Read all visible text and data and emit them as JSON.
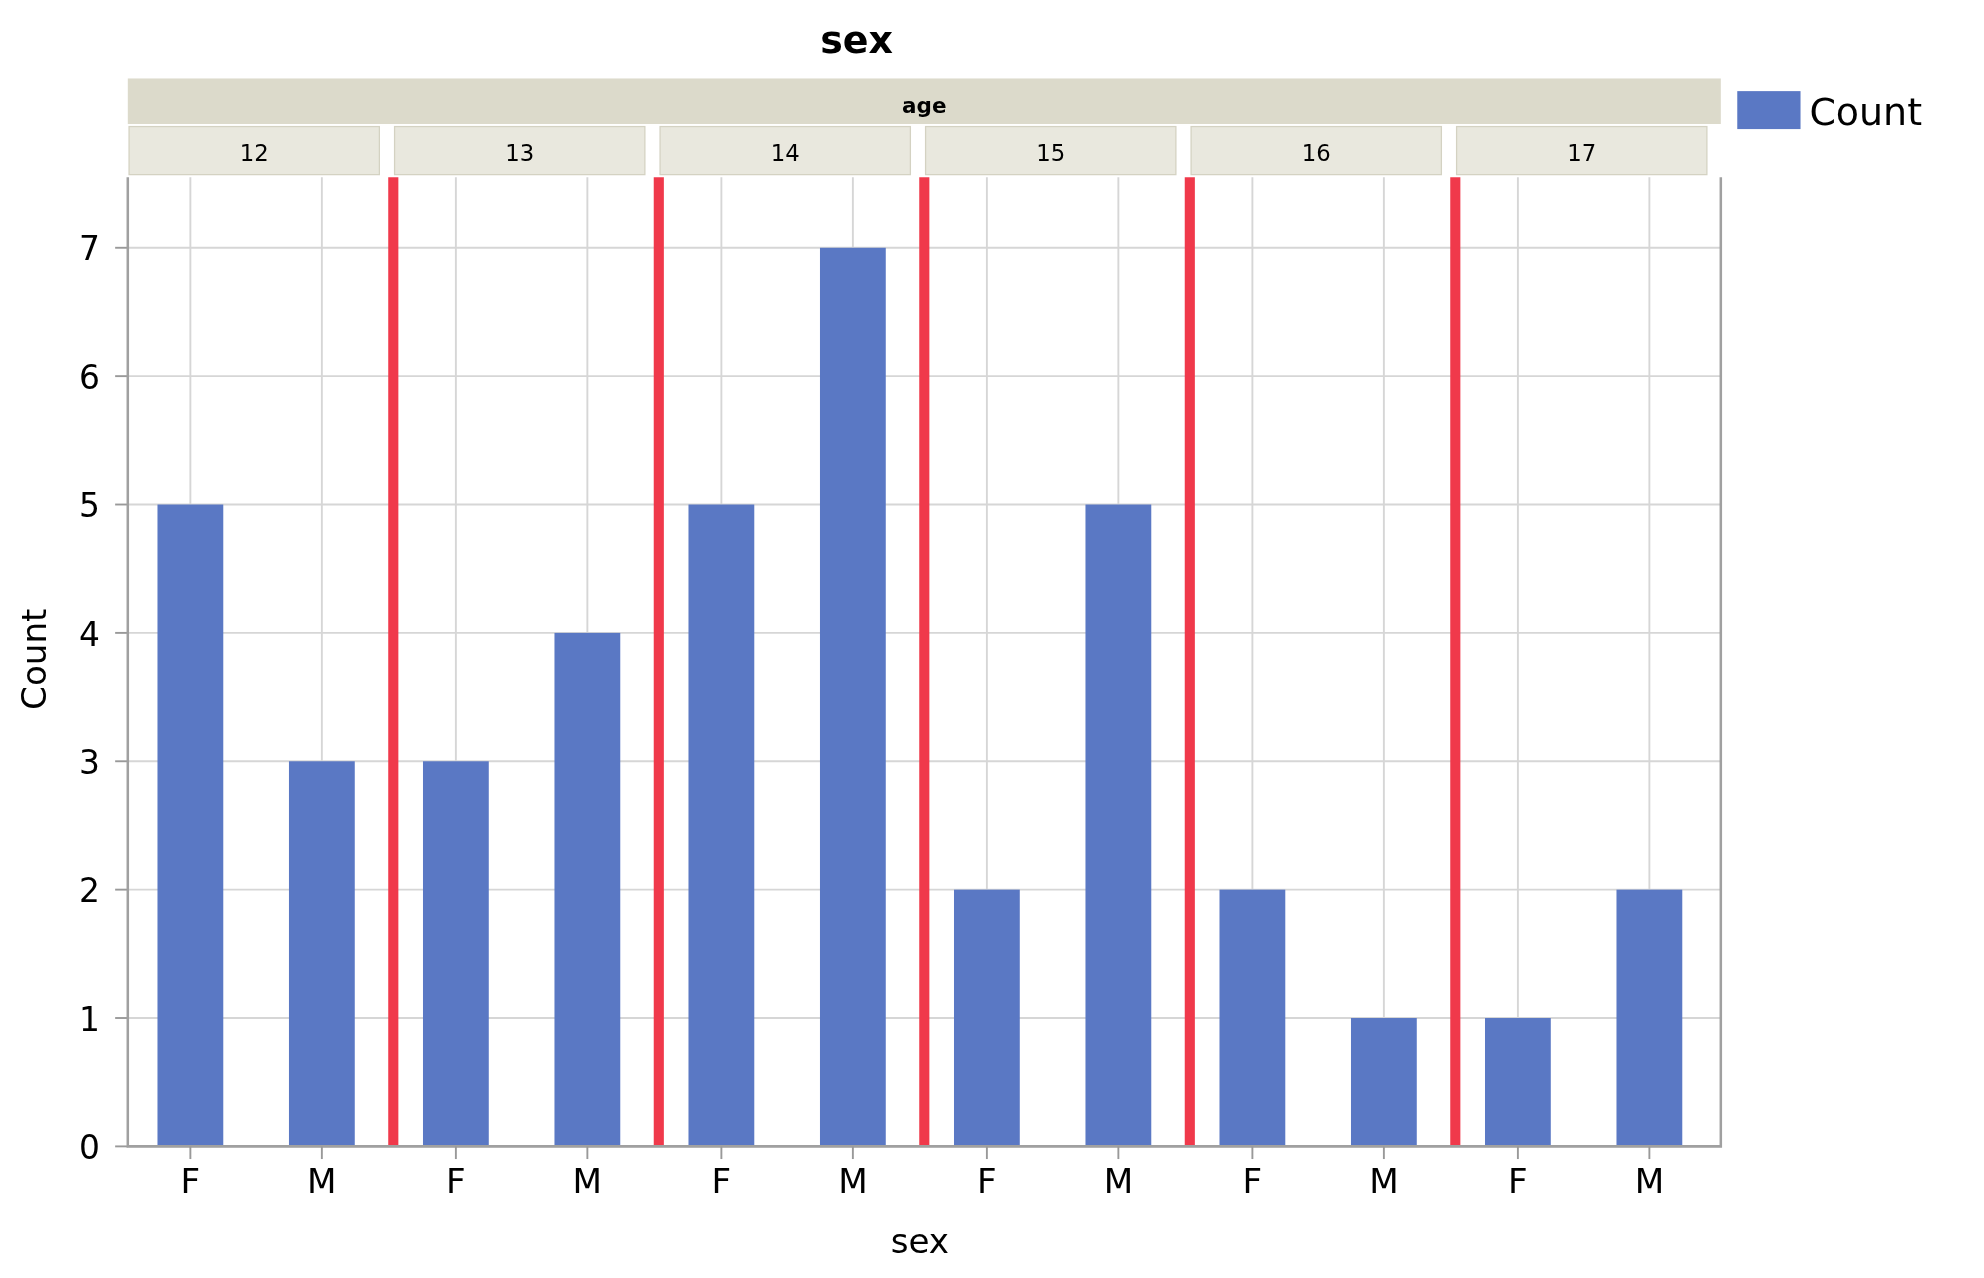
{
  "chart_data": {
    "type": "bar",
    "title": "sex",
    "xlabel": "sex",
    "ylabel": "Count",
    "categories": [
      "F",
      "M",
      "F",
      "M",
      "F",
      "M",
      "F",
      "M",
      "F",
      "M",
      "F",
      "M"
    ],
    "series": [
      {
        "name": "Count",
        "color": "#5a78c4",
        "values": [
          5,
          3,
          3,
          4,
          5,
          7,
          2,
          5,
          2,
          1,
          1,
          2
        ]
      }
    ],
    "ylim": [
      0,
      7.55
    ],
    "yticks": [
      0,
      1,
      2,
      3,
      4,
      5,
      6,
      7
    ],
    "grid": true
  },
  "facet": {
    "title": "age",
    "groups": [
      "12",
      "13",
      "14",
      "15",
      "16",
      "17"
    ]
  }
}
